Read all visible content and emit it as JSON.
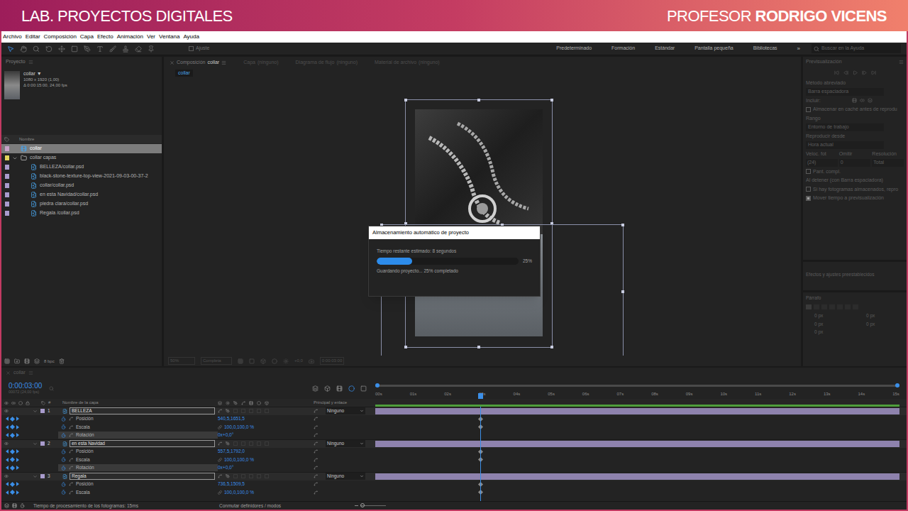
{
  "banner": {
    "left": "LAB. PROYECTOS DIGITALES",
    "right_light": "PROFESOR",
    "right_bold": "RODRIGO VICENS"
  },
  "menu": [
    "Archivo",
    "Editar",
    "Composición",
    "Capa",
    "Efecto",
    "Animación",
    "Ver",
    "Ventana",
    "Ayuda"
  ],
  "toolbar": {
    "snap": {
      "label": "Ajuste",
      "checked": false
    },
    "workspaces": [
      {
        "label": "Predeterminado",
        "selected": false
      },
      {
        "label": "Formación",
        "selected": false
      },
      {
        "label": "Estándar",
        "selected": false
      },
      {
        "label": "Pantalla pequeña",
        "selected": false
      },
      {
        "label": "Bibliotecas",
        "selected": false
      }
    ],
    "more": "»",
    "search_placeholder": "Buscar en la Ayuda"
  },
  "project": {
    "title": "Proyecto",
    "comp_name": "collar ▼",
    "comp_size": "1080 x 1920 (1,00)",
    "comp_duration": "Δ 0:00:15:00, 24,00 fps",
    "column": "Nombre",
    "items": [
      {
        "name": "collar",
        "kind": "comp",
        "color": "#c9a3c9",
        "selected": true,
        "expanded": false,
        "children": []
      },
      {
        "name": "collar capas",
        "kind": "folder",
        "color": "#e2d45c",
        "selected": false,
        "expanded": true,
        "children": [
          {
            "name": "BELLEZA/collar.psd",
            "kind": "file",
            "color": "#a99ccd",
            "selected": false,
            "expanded": false,
            "children": []
          },
          {
            "name": "black-stone-texture-top-view-2021-09-03-00-37-2",
            "kind": "file",
            "color": "#a99ccd",
            "selected": false,
            "expanded": false,
            "children": []
          },
          {
            "name": "collar/collar.psd",
            "kind": "file",
            "color": "#a99ccd",
            "selected": false,
            "expanded": false,
            "children": []
          },
          {
            "name": "en esta Navidad/collar.psd",
            "kind": "file",
            "color": "#a99ccd",
            "selected": false,
            "expanded": false,
            "children": []
          },
          {
            "name": "piedra clara/collar.psd",
            "kind": "file",
            "color": "#a99ccd",
            "selected": false,
            "expanded": false,
            "children": []
          },
          {
            "name": "Regala /collar.psd",
            "kind": "file",
            "color": "#a99ccd",
            "selected": false,
            "expanded": false,
            "children": []
          }
        ]
      }
    ],
    "depth": "8 bpc"
  },
  "viewer": {
    "tabs": [
      {
        "prefix": "Composición",
        "label": "collar",
        "selected": true
      },
      {
        "prefix": "Capa",
        "label": "(ninguno)",
        "selected": false
      },
      {
        "prefix": "Diagrama de flujo",
        "label": "(ninguno)",
        "selected": false
      },
      {
        "prefix": "Material de archivo",
        "label": "(ninguno)",
        "selected": false
      }
    ],
    "subtab": "collar",
    "zoom": "50%",
    "resolution": "Completa",
    "exposure": "+0,0",
    "time": "0:00:03:00"
  },
  "dialog": {
    "title": "Almacenamiento automático de proyecto",
    "remaining": "Tiempo restante estimado: 8 segundos",
    "level": 0.25,
    "percent": "25%",
    "status": "Guardando proyecto... 25% completado"
  },
  "preview": {
    "title": "Previsualización",
    "shortcut_label": "Método abreviado",
    "shortcut": "Barra espaciadora",
    "include": "Incluir:",
    "cache": {
      "label": "Almacenar en caché antes de reprodu",
      "checked": false
    },
    "range_label": "Rango",
    "range": "Entorno de trabajo",
    "play_from_label": "Reproducir desde",
    "play_from": "Hora actual",
    "fps_labels": [
      "Veloc. fot",
      "Omitir",
      "Resolución"
    ],
    "fps_values": [
      "(24)",
      "0",
      "Total"
    ],
    "fullscreen": {
      "label": "Pant. compl.",
      "checked": false
    },
    "on_stop": "Al detener (con Barra espaciadora)",
    "cached": {
      "label": "Si hay fotogramas almacenados, repro",
      "checked": false
    },
    "move_time": {
      "label": "Mover tiempo a previsualización",
      "checked": true
    }
  },
  "effects": {
    "title": "Efectos y ajustes preestablecidos"
  },
  "paragraph": {
    "title": "Párrafo",
    "fields": [
      "0 px",
      "0 px",
      "0 px",
      "0 px",
      "0 px"
    ]
  },
  "timeline": {
    "tab": "collar",
    "time": "0:00:03:00",
    "frames": "00072 (24,00 fps)",
    "columns": {
      "number": "#",
      "name": "Nombre de la capa",
      "parent": "Principal y enlace"
    },
    "ruler": [
      "00s",
      "01s",
      "02s",
      "03s",
      "04s",
      "05s",
      "06s",
      "07s",
      "08s",
      "09s",
      "10s",
      "11s",
      "12s",
      "13s",
      "14s",
      "15s"
    ],
    "playhead": 0.2,
    "layers": [
      {
        "index": "1",
        "name": "BELLEZA",
        "color": "#a99ccd",
        "selected": true,
        "parent": "Ninguno",
        "properties": [
          {
            "name": "Posición",
            "value": "540,5,1651,5",
            "kind": "position",
            "keyframe": true,
            "selected": false
          },
          {
            "name": "Escala",
            "value": "100,0,100,0 %",
            "kind": "scale",
            "keyframe": true,
            "selected": false
          },
          {
            "name": "Rotación",
            "value": "0x+0,0°",
            "kind": "rotation",
            "keyframe": false,
            "selected": true
          }
        ]
      },
      {
        "index": "2",
        "name": "en esta Navidad",
        "color": "#a99ccd",
        "selected": true,
        "parent": "Ninguno",
        "properties": [
          {
            "name": "Posición",
            "value": "557,5,1792,0",
            "kind": "position",
            "keyframe": true,
            "selected": false
          },
          {
            "name": "Escala",
            "value": "100,0,100,0 %",
            "kind": "scale",
            "keyframe": true,
            "selected": false
          },
          {
            "name": "Rotación",
            "value": "0x+0,0°",
            "kind": "rotation",
            "keyframe": false,
            "selected": true
          }
        ]
      },
      {
        "index": "3",
        "name": "Regala",
        "color": "#a99ccd",
        "selected": true,
        "parent": "Ninguno",
        "properties": [
          {
            "name": "Posición",
            "value": "736,5,1509,5",
            "kind": "position",
            "keyframe": true,
            "selected": false
          },
          {
            "name": "Escala",
            "value": "100,0,100,0 %",
            "kind": "scale",
            "keyframe": true,
            "selected": false
          }
        ]
      }
    ]
  },
  "status_bar": {
    "render_time": "Tiempo de procesamiento de los fotogramas: 15ms",
    "toggle": "Conmutar definidores / modos"
  }
}
